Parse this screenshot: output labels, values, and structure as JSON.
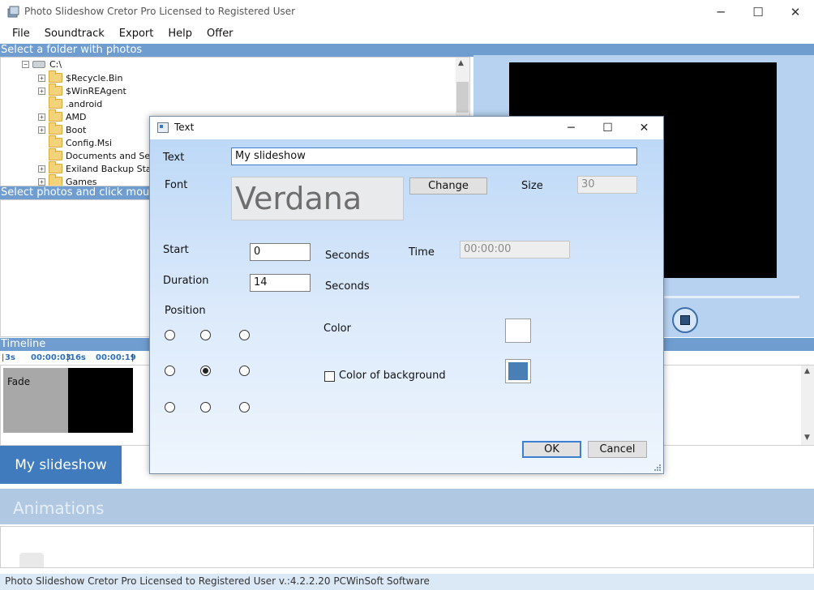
{
  "window": {
    "title": "Photo Slideshow Cretor Pro Licensed to Registered User",
    "minimize": "─",
    "maximize": "☐",
    "close": "✕"
  },
  "menu": [
    "File",
    "Soundtrack",
    "Export",
    "Help",
    "Offer"
  ],
  "folder_panel": {
    "header": "Select a folder with photos",
    "root": "C:\\",
    "items": [
      {
        "label": "$Recycle.Bin",
        "expandable": true
      },
      {
        "label": "$WinREAgent",
        "expandable": true
      },
      {
        "label": ".android",
        "expandable": false
      },
      {
        "label": "AMD",
        "expandable": true
      },
      {
        "label": "Boot",
        "expandable": true
      },
      {
        "label": "Config.Msi",
        "expandable": false
      },
      {
        "label": "Documents and Settings",
        "expandable": false
      },
      {
        "label": "Exiland Backup Standard",
        "expandable": true
      },
      {
        "label": "Games",
        "expandable": true
      }
    ]
  },
  "photos_panel": {
    "header": "Select photos and click mouse"
  },
  "timeline": {
    "header": "Timeline",
    "ruler": [
      "3s",
      "00:00:03",
      "16s",
      "00:00:19"
    ],
    "clip_label": "Fade"
  },
  "tabs": {
    "active": "My slideshow",
    "animations": "Animations"
  },
  "status": "Photo Slideshow Cretor Pro Licensed to Registered User v.:4.2.2.20 PCWinSoft Software",
  "dialog": {
    "title": "Text",
    "text_label": "Text",
    "text_value": "My slideshow",
    "font_label": "Font",
    "font_preview": "Verdana",
    "change_button": "Change",
    "size_label": "Size",
    "size_value": "30",
    "start_label": "Start",
    "start_value": "0",
    "seconds1": "Seconds",
    "time_label": "Time",
    "time_value": "00:00:00",
    "duration_label": "Duration",
    "duration_value": "14",
    "seconds2": "Seconds",
    "position_label": "Position",
    "selected_position": "middle-center",
    "color_label": "Color",
    "color_value": "#ffffff",
    "bg_color_label": "Color of background",
    "bg_color_checked": false,
    "bg_color_value": "#4a7fb5",
    "ok_button": "OK",
    "cancel_button": "Cancel"
  }
}
